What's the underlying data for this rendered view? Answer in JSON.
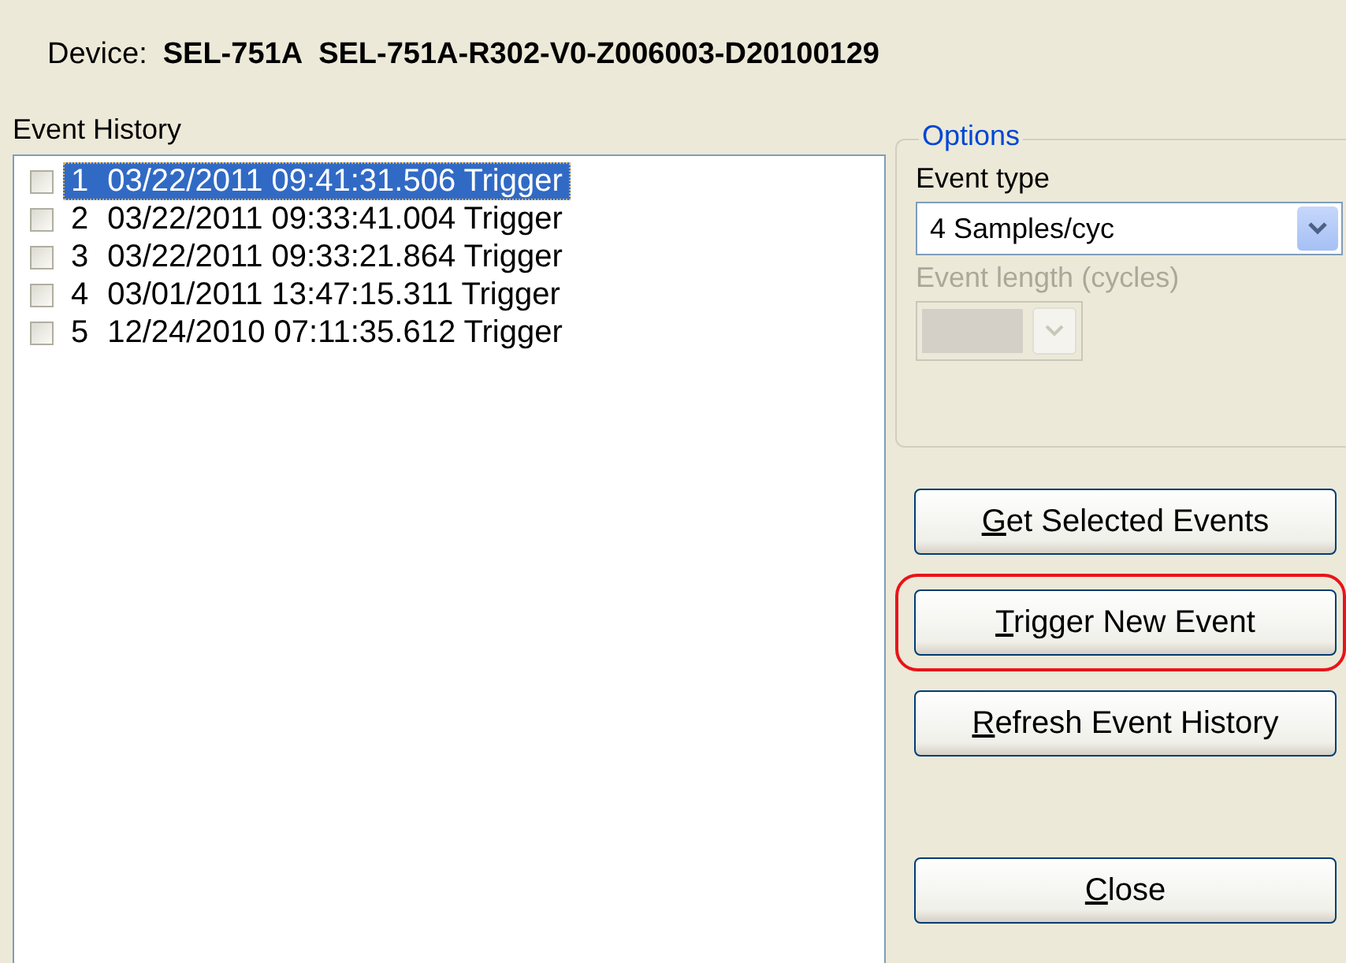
{
  "device": {
    "label": "Device:",
    "model": "SEL-751A",
    "firmware": "SEL-751A-R302-V0-Z006003-D20100129"
  },
  "event_history": {
    "label": "Event History",
    "events": [
      {
        "number": "1",
        "text": "03/22/2011 09:41:31.506 Trigger",
        "checked": false,
        "selected": true
      },
      {
        "number": "2",
        "text": "03/22/2011 09:33:41.004 Trigger",
        "checked": false,
        "selected": false
      },
      {
        "number": "3",
        "text": "03/22/2011 09:33:21.864 Trigger",
        "checked": false,
        "selected": false
      },
      {
        "number": "4",
        "text": "03/01/2011 13:47:15.311 Trigger",
        "checked": false,
        "selected": false
      },
      {
        "number": "5",
        "text": "12/24/2010 07:11:35.612 Trigger",
        "checked": false,
        "selected": false
      }
    ]
  },
  "options": {
    "title": "Options",
    "event_type": {
      "label": "Event type",
      "value": "4 Samples/cyc",
      "disabled": false
    },
    "event_length": {
      "label": "Event length (cycles)",
      "disabled": true
    }
  },
  "buttons": [
    {
      "label": "Get Selected Events",
      "underline_first": true,
      "highlighted": false,
      "kind": "action"
    },
    {
      "label": "Trigger New Event",
      "underline_first": true,
      "highlighted": true,
      "kind": "action"
    },
    {
      "label": "Refresh Event History",
      "underline_first": true,
      "highlighted": false,
      "kind": "action"
    },
    {
      "label": "Close",
      "underline_first": true,
      "highlighted": false,
      "kind": "close"
    }
  ]
}
